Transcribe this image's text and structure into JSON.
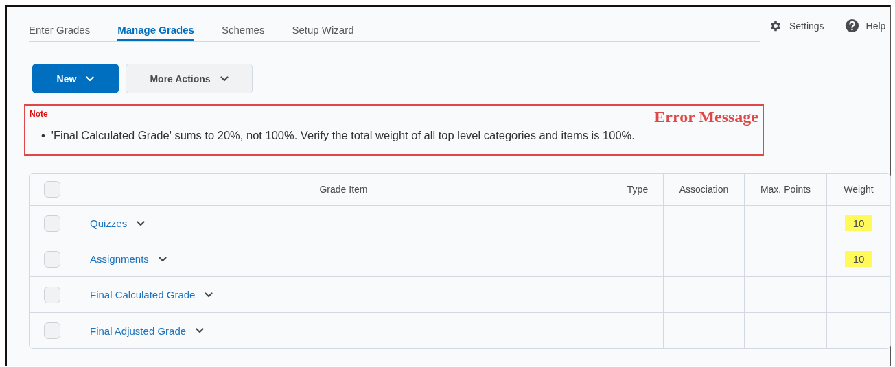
{
  "tabs": [
    {
      "label": "Enter Grades",
      "selected": false
    },
    {
      "label": "Manage Grades",
      "selected": true
    },
    {
      "label": "Schemes",
      "selected": false
    },
    {
      "label": "Setup Wizard",
      "selected": false
    }
  ],
  "header_links": [
    {
      "kind": "settings",
      "label": "Settings"
    },
    {
      "kind": "help",
      "label": "Help"
    }
  ],
  "buttons": [
    {
      "label": "New",
      "primary": true
    },
    {
      "label": "More Actions",
      "primary": false
    }
  ],
  "note": {
    "title": "Note",
    "annotation": "Error Message",
    "bullet": "•",
    "items": [
      "'Final Calculated Grade' sums to 20%, not 100%. Verify the total weight of all top level categories and items is 100%."
    ]
  },
  "table": {
    "all_checked": false,
    "columns": [
      "Grade Item",
      "Type",
      "Association",
      "Max. Points",
      "Weight"
    ],
    "rows": [
      {
        "name": "Quizzes",
        "checked": false,
        "weight": "10",
        "highlighted": true
      },
      {
        "name": "Assignments",
        "checked": false,
        "weight": "10",
        "highlighted": true
      },
      {
        "name": "Final Calculated Grade",
        "checked": false
      },
      {
        "name": "Final Adjusted Grade",
        "checked": false
      }
    ]
  }
}
